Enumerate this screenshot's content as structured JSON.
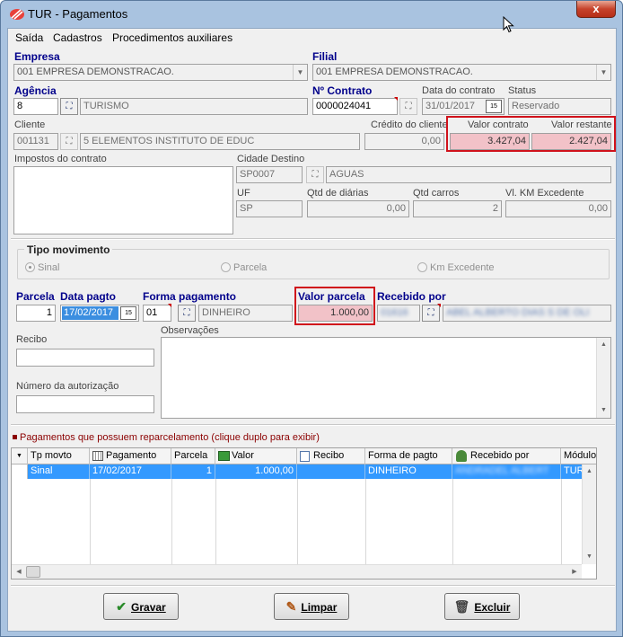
{
  "window": {
    "title": "TUR - Pagamentos",
    "close": "x"
  },
  "menu": [
    "Saída",
    "Cadastros",
    "Procedimentos auxiliares"
  ],
  "empresa": {
    "label": "Empresa",
    "value": "001 EMPRESA DEMONSTRACAO."
  },
  "filial": {
    "label": "Filial",
    "value": "001 EMPRESA DEMONSTRACAO."
  },
  "agencia": {
    "label": "Agência",
    "code": "8",
    "name": "TURISMO"
  },
  "contrato": {
    "label": "Nº Contrato",
    "value": "0000024041"
  },
  "data_contrato": {
    "label": "Data do contrato",
    "value": "31/01/2017"
  },
  "status": {
    "label": "Status",
    "value": "Reservado"
  },
  "cliente": {
    "label": "Cliente",
    "code": "001131",
    "name": "5 ELEMENTOS INSTITUTO DE EDUC"
  },
  "credito": {
    "label": "Crédito do cliente",
    "value": "0,00"
  },
  "valor_contrato": {
    "label": "Valor contrato",
    "value": "3.427,04"
  },
  "valor_restante": {
    "label": "Valor restante",
    "value": "2.427,04"
  },
  "impostos": {
    "label": "Impostos do contrato"
  },
  "cidade": {
    "label": "Cidade Destino",
    "code": "SP0007",
    "name": "AGUAS"
  },
  "uf": {
    "label": "UF",
    "value": "SP"
  },
  "diarias": {
    "label": "Qtd de diárias",
    "value": "0,00"
  },
  "carros": {
    "label": "Qtd carros",
    "value": "2"
  },
  "km": {
    "label": "Vl. KM Excedente",
    "value": "0,00"
  },
  "tipo": {
    "label": "Tipo movimento",
    "options": [
      "Sinal",
      "Parcela",
      "Km Excedente"
    ],
    "selected": "Sinal"
  },
  "parcela": {
    "label": "Parcela",
    "value": "1"
  },
  "data_pagto": {
    "label": "Data pagto",
    "value": "17/02/2017"
  },
  "forma": {
    "label": "Forma pagamento",
    "code": "01",
    "name": "DINHEIRO"
  },
  "valor_parcela": {
    "label": "Valor parcela",
    "value": "1.000,00"
  },
  "recebido": {
    "label": "Recebido por",
    "code": "01616",
    "name": "ABEL ALBERTO DIAS S DE OLI"
  },
  "recibo": {
    "label": "Recibo"
  },
  "observacoes": {
    "label": "Observações"
  },
  "autorizacao": {
    "label": "Número da autorização"
  },
  "grid": {
    "title": "Pagamentos que possuem reparcelamento (clique duplo para exibir)",
    "columns": [
      "Tp movto",
      "Pagamento",
      "Parcela",
      "Valor",
      "Recibo",
      "Forma de pagto",
      "Recebido por",
      "Módulo"
    ],
    "rows": [
      {
        "tp": "Sinal",
        "pagamento": "17/02/2017",
        "parcela": "1",
        "valor": "1.000,00",
        "recibo": "",
        "forma": "DINHEIRO",
        "recebido": "ANDRADEL ALBERT",
        "modulo": "TUR"
      }
    ]
  },
  "buttons": {
    "gravar": "Gravar",
    "limpar": "Limpar",
    "excluir": "Excluir"
  },
  "colors": {
    "title_bg": "#a9c3e0",
    "highlight": "#d0121b",
    "selection": "#3399ff",
    "label_blue": "#00008b"
  }
}
